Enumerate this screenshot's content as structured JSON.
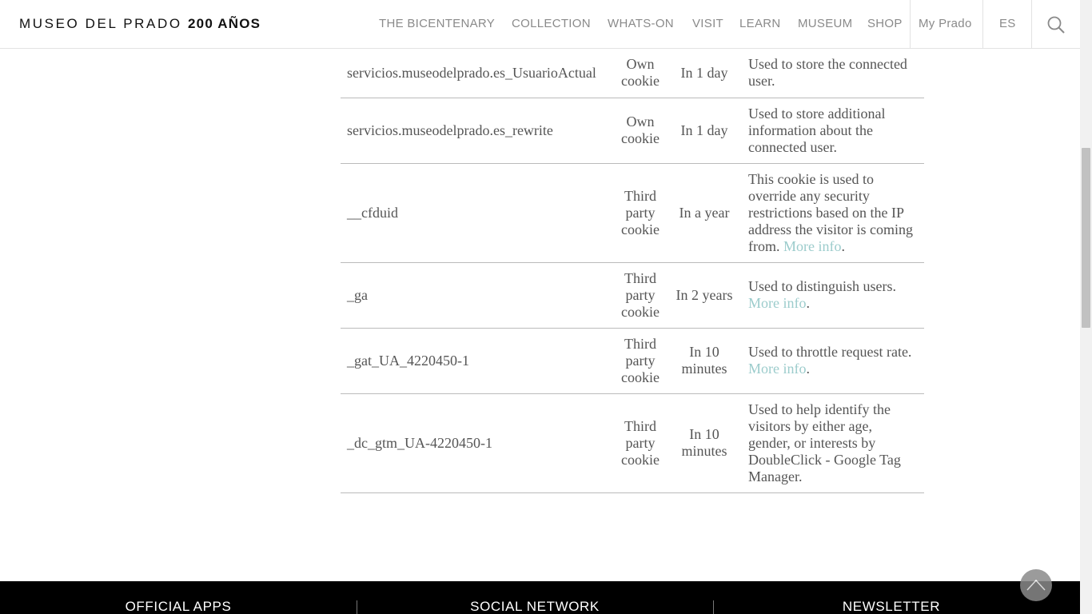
{
  "header": {
    "logo_text": "MUSEO DEL PRADO",
    "logo_bold": "200 AÑOS",
    "nav": [
      "THE BICENTENARY",
      "COLLECTION",
      "WHATS-ON",
      "VISIT",
      "LEARN",
      "MUSEUM",
      "SHOP"
    ],
    "my_prado": "My Prado",
    "language": "ES"
  },
  "cookies": [
    {
      "name": "servicios.museodelprado.es_UsuarioActual",
      "type": "Own cookie",
      "expires": "In 1 day",
      "description": "Used to store the connected user.",
      "link": ""
    },
    {
      "name": "servicios.museodelprado.es_rewrite",
      "type": "Own cookie",
      "expires": "In 1 day",
      "description": "Used to store additional information about the connected user.",
      "link": ""
    },
    {
      "name": "__cfduid",
      "type": "Third party cookie",
      "expires": "In a year",
      "description": "This cookie is used to override any security restrictions based on the IP address the visitor is coming from.",
      "link": "More info"
    },
    {
      "name": "_ga",
      "type": "Third party cookie",
      "expires": "In 2 years",
      "description": "Used to distinguish users.",
      "link": "More info"
    },
    {
      "name": "_gat_UA_4220450-1",
      "type": "Third party cookie",
      "expires": "In 10 minutes",
      "description": "Used to throttle request rate.",
      "link": "More info"
    },
    {
      "name": "_dc_gtm_UA-4220450-1",
      "type": "Third party cookie",
      "expires": "In 10 minutes",
      "description": "Used to help identify the visitors by either age, gender, or interests by DoubleClick - Google Tag Manager.",
      "link": ""
    }
  ],
  "footer": {
    "sections": [
      "OFFICIAL APPS",
      "SOCIAL NETWORK",
      "NEWSLETTER"
    ]
  },
  "icons": {
    "search": "search-icon",
    "back_to_top": "chevron-up-icon"
  },
  "colors": {
    "link": "#9ccccc",
    "footer_bg": "#000000",
    "nav_text": "#8a8a8a"
  }
}
